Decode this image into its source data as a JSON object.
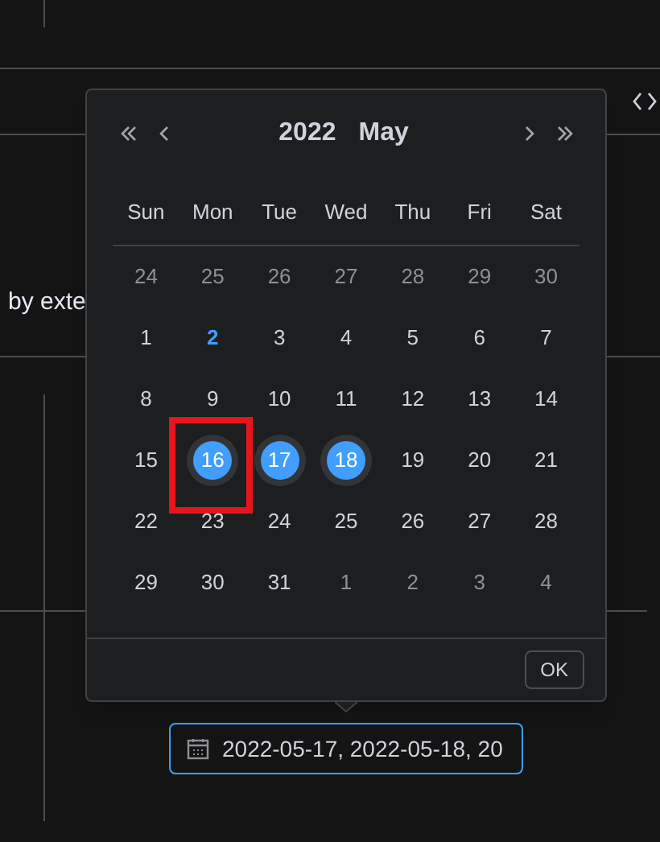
{
  "background": {
    "text": "by exte"
  },
  "picker": {
    "year": "2022",
    "month": "May",
    "weekdays": [
      "Sun",
      "Mon",
      "Tue",
      "Wed",
      "Thu",
      "Fri",
      "Sat"
    ],
    "weeks": [
      [
        {
          "label": "24",
          "kind": "other",
          "selected": false,
          "marked": false
        },
        {
          "label": "25",
          "kind": "other",
          "selected": false,
          "marked": false
        },
        {
          "label": "26",
          "kind": "other",
          "selected": false,
          "marked": false
        },
        {
          "label": "27",
          "kind": "other",
          "selected": false,
          "marked": false
        },
        {
          "label": "28",
          "kind": "other",
          "selected": false,
          "marked": false
        },
        {
          "label": "29",
          "kind": "other",
          "selected": false,
          "marked": false
        },
        {
          "label": "30",
          "kind": "other",
          "selected": false,
          "marked": false
        }
      ],
      [
        {
          "label": "1",
          "kind": "day",
          "selected": false,
          "marked": false
        },
        {
          "label": "2",
          "kind": "today",
          "selected": false,
          "marked": false
        },
        {
          "label": "3",
          "kind": "day",
          "selected": false,
          "marked": false
        },
        {
          "label": "4",
          "kind": "day",
          "selected": false,
          "marked": false
        },
        {
          "label": "5",
          "kind": "day",
          "selected": false,
          "marked": false
        },
        {
          "label": "6",
          "kind": "day",
          "selected": false,
          "marked": false
        },
        {
          "label": "7",
          "kind": "day",
          "selected": false,
          "marked": false
        }
      ],
      [
        {
          "label": "8",
          "kind": "day",
          "selected": false,
          "marked": false
        },
        {
          "label": "9",
          "kind": "day",
          "selected": false,
          "marked": false
        },
        {
          "label": "10",
          "kind": "day",
          "selected": false,
          "marked": false
        },
        {
          "label": "11",
          "kind": "day",
          "selected": false,
          "marked": false
        },
        {
          "label": "12",
          "kind": "day",
          "selected": false,
          "marked": false
        },
        {
          "label": "13",
          "kind": "day",
          "selected": false,
          "marked": false
        },
        {
          "label": "14",
          "kind": "day",
          "selected": false,
          "marked": false
        }
      ],
      [
        {
          "label": "15",
          "kind": "day",
          "selected": false,
          "marked": false
        },
        {
          "label": "16",
          "kind": "day",
          "selected": true,
          "marked": true
        },
        {
          "label": "17",
          "kind": "day",
          "selected": true,
          "marked": false
        },
        {
          "label": "18",
          "kind": "day",
          "selected": true,
          "marked": false
        },
        {
          "label": "19",
          "kind": "day",
          "selected": false,
          "marked": false
        },
        {
          "label": "20",
          "kind": "day",
          "selected": false,
          "marked": false
        },
        {
          "label": "21",
          "kind": "day",
          "selected": false,
          "marked": false
        }
      ],
      [
        {
          "label": "22",
          "kind": "day",
          "selected": false,
          "marked": false
        },
        {
          "label": "23",
          "kind": "day",
          "selected": false,
          "marked": false
        },
        {
          "label": "24",
          "kind": "day",
          "selected": false,
          "marked": false
        },
        {
          "label": "25",
          "kind": "day",
          "selected": false,
          "marked": false
        },
        {
          "label": "26",
          "kind": "day",
          "selected": false,
          "marked": false
        },
        {
          "label": "27",
          "kind": "day",
          "selected": false,
          "marked": false
        },
        {
          "label": "28",
          "kind": "day",
          "selected": false,
          "marked": false
        }
      ],
      [
        {
          "label": "29",
          "kind": "day",
          "selected": false,
          "marked": false
        },
        {
          "label": "30",
          "kind": "day",
          "selected": false,
          "marked": false
        },
        {
          "label": "31",
          "kind": "day",
          "selected": false,
          "marked": false
        },
        {
          "label": "1",
          "kind": "other",
          "selected": false,
          "marked": false
        },
        {
          "label": "2",
          "kind": "other",
          "selected": false,
          "marked": false
        },
        {
          "label": "3",
          "kind": "other",
          "selected": false,
          "marked": false
        },
        {
          "label": "4",
          "kind": "other",
          "selected": false,
          "marked": false
        }
      ]
    ],
    "ok_button": "OK"
  },
  "date_input": {
    "value": "2022-05-17, 2022-05-18, 20",
    "focused": true
  }
}
